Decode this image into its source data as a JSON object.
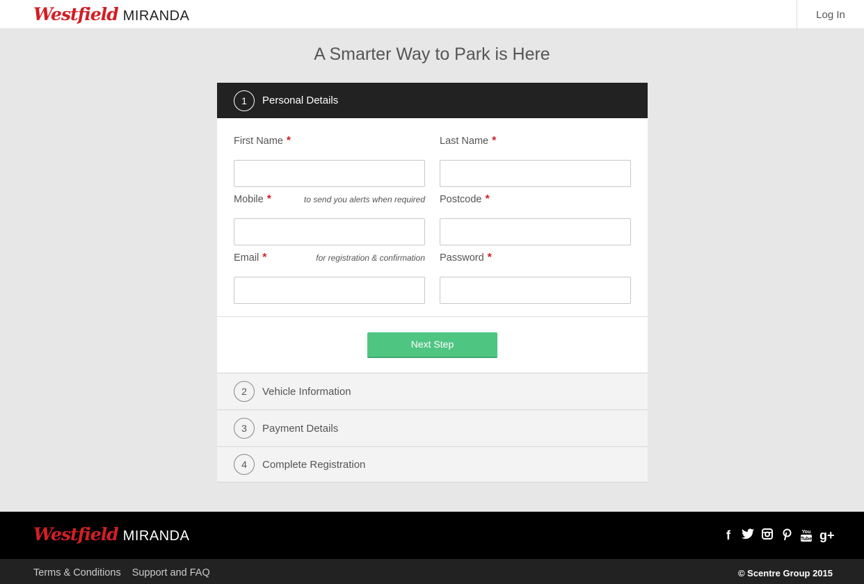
{
  "header": {
    "brand_name": "Westfield",
    "brand_location": "MIRANDA",
    "login_label": "Log In"
  },
  "page_title": "A Smarter Way to Park is Here",
  "steps": [
    {
      "number": "1",
      "title": "Personal Details"
    },
    {
      "number": "2",
      "title": "Vehicle Information"
    },
    {
      "number": "3",
      "title": "Payment Details"
    },
    {
      "number": "4",
      "title": "Complete Registration"
    }
  ],
  "form": {
    "first_name": {
      "label": "First Name",
      "required": "*",
      "value": ""
    },
    "last_name": {
      "label": "Last Name",
      "required": "*",
      "value": ""
    },
    "mobile": {
      "label": "Mobile",
      "required": "*",
      "hint": "to send you alerts when required",
      "value": ""
    },
    "postcode": {
      "label": "Postcode",
      "required": "*",
      "value": ""
    },
    "email": {
      "label": "Email",
      "required": "*",
      "hint": "for registration & confirmation",
      "value": ""
    },
    "password": {
      "label": "Password",
      "required": "*",
      "value": ""
    },
    "next_label": "Next Step"
  },
  "footer": {
    "brand_name": "Westfield",
    "brand_location": "MIRANDA",
    "social_icons": [
      "facebook-icon",
      "twitter-icon",
      "instagram-icon",
      "pinterest-icon",
      "youtube-icon",
      "google-plus-icon"
    ],
    "links": [
      "Terms & Conditions",
      "Support and FAQ"
    ],
    "copyright": "© Scentre Group 2015"
  },
  "colors": {
    "brand_red": "#d11f26",
    "accent_green": "#4fc582",
    "active_step_bg": "#222222"
  }
}
